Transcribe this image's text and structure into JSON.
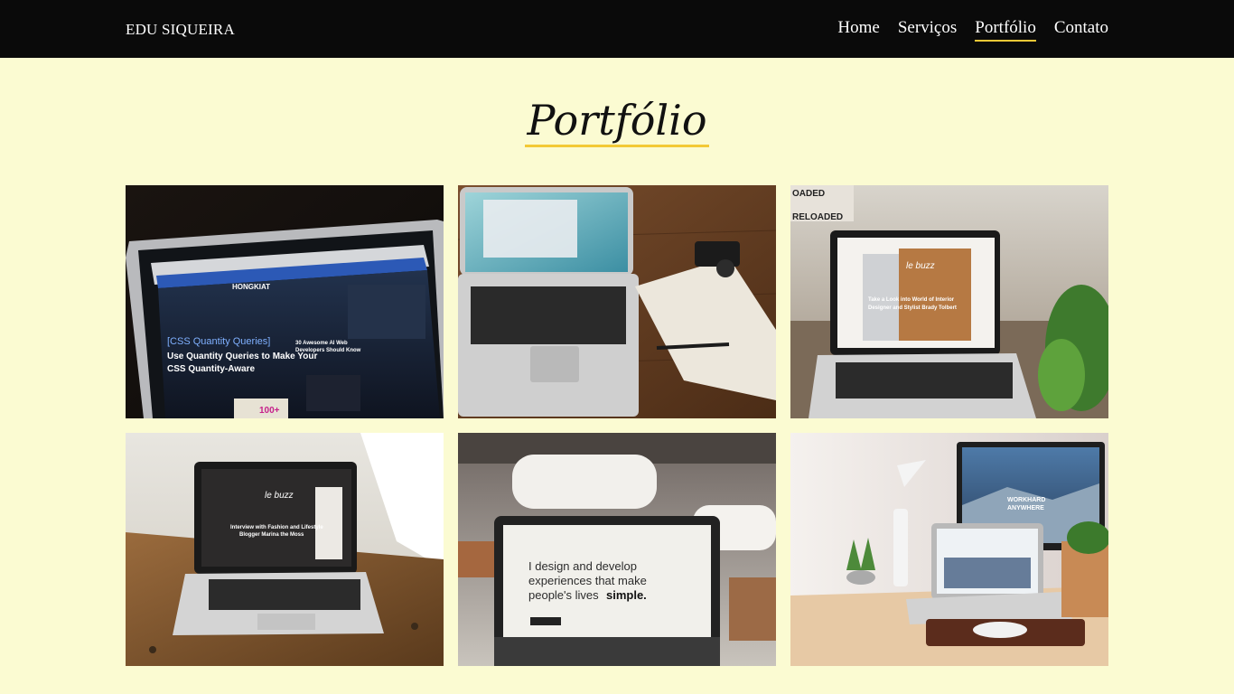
{
  "header": {
    "brand": "EDU SIQUEIRA",
    "nav": [
      "Home",
      "Serviços",
      "Portfólio",
      "Contato"
    ],
    "active_index": 2
  },
  "main": {
    "title": "Portfólio"
  },
  "portfolio": {
    "items": [
      {
        "screen_lines": [
          "HONGKIAT",
          "[CSS Quantity Queries]",
          "Use Quantity Queries to Make Your",
          "CSS Quantity-Aware",
          "30 Awesome AI Web",
          "Developers Should Know",
          "100+"
        ]
      },
      {
        "screen_lines": []
      },
      {
        "screen_lines": [
          "le buzz",
          "Take a Look into World of Interior",
          "Designer and Stylist Brady Tolbert"
        ]
      },
      {
        "screen_lines": [
          "le buzz",
          "Interview with Fashion and Lifestyle",
          "Blogger Marina the Moss"
        ]
      },
      {
        "screen_lines": [
          "I design and develop",
          "experiences that make",
          "people's lives",
          "simple."
        ]
      },
      {
        "screen_lines": [
          "WORKHARD",
          "ANYWHERE"
        ]
      }
    ]
  },
  "colors": {
    "background": "#fbfbd2",
    "header": "#0a0a0a",
    "accent": "#f3c936"
  }
}
